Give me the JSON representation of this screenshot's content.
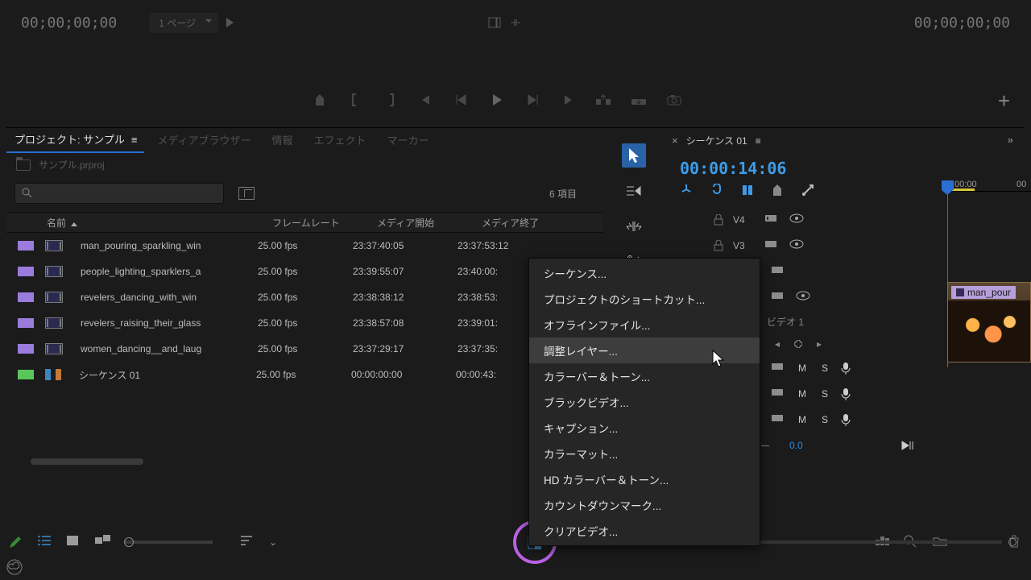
{
  "top": {
    "tc_left": "00;00;00;00",
    "tc_right": "00;00;00;00",
    "page_label": "1 ページ"
  },
  "panels": {
    "tabs": [
      "プロジェクト: サンプル",
      "メディアブラウザー",
      "情報",
      "エフェクト",
      "マーカー"
    ],
    "active": 0
  },
  "project": {
    "bin": "サンプル.prproj",
    "count": "6 項目",
    "columns": {
      "name": "名前",
      "fps": "フレームレート",
      "start": "メディア開始",
      "end": "メディア終了"
    },
    "rows": [
      {
        "swatch": "purple",
        "type": "clip",
        "name": "man_pouring_sparkling_win",
        "fps": "25.00 fps",
        "start": "23:37:40:05",
        "end": "23:37:53:12"
      },
      {
        "swatch": "purple",
        "type": "clip",
        "name": "people_lighting_sparklers_a",
        "fps": "25.00 fps",
        "start": "23:39:55:07",
        "end": "23:40:00:"
      },
      {
        "swatch": "purple",
        "type": "clip",
        "name": "revelers_dancing_with_win",
        "fps": "25.00 fps",
        "start": "23:38:38:12",
        "end": "23:38:53:"
      },
      {
        "swatch": "purple",
        "type": "clip",
        "name": "revelers_raising_their_glass",
        "fps": "25.00 fps",
        "start": "23:38:57:08",
        "end": "23:39:01:"
      },
      {
        "swatch": "purple",
        "type": "clip",
        "name": "women_dancing__and_laug",
        "fps": "25.00 fps",
        "start": "23:37:29:17",
        "end": "23:37:35:"
      },
      {
        "swatch": "green",
        "type": "seq",
        "name": "シーケンス 01",
        "fps": "25.00 fps",
        "start": "00:00:00:00",
        "end": "00:00:43:"
      }
    ]
  },
  "timeline": {
    "title": "シーケンス 01",
    "tc": "00:00:14:06",
    "ruler_start": ":00:00",
    "ruler_next": "00",
    "tracks_v": [
      "V4",
      "V3"
    ],
    "v_label": "ビデオ 1",
    "audio_val": "0.0",
    "clip_label": "man_pour"
  },
  "ctx": [
    "シーケンス...",
    "プロジェクトのショートカット...",
    "オフラインファイル...",
    "調整レイヤー...",
    "カラーバー＆トーン...",
    "ブラックビデオ...",
    "キャプション...",
    "カラーマット...",
    "HD カラーバー＆トーン...",
    "カウントダウンマーク...",
    "クリアビデオ..."
  ],
  "ctx_highlight": 3,
  "audio_labels": {
    "m": "M",
    "s": "S"
  }
}
